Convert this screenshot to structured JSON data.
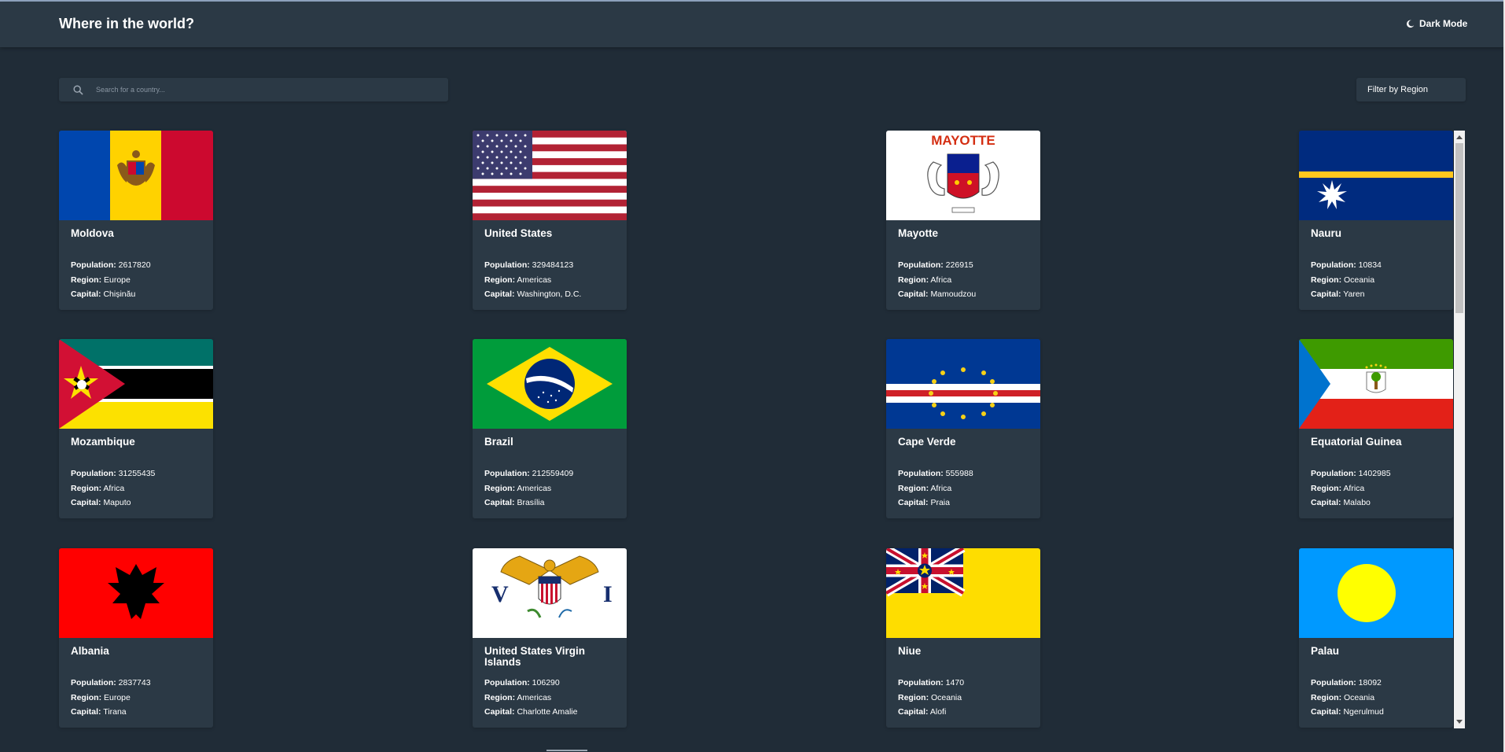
{
  "header": {
    "title": "Where in the world?",
    "dark_mode_label": "Dark Mode",
    "dark_mode_icon": "moon-icon"
  },
  "search": {
    "placeholder": "Search for a country...",
    "value": "",
    "icon": "search-icon"
  },
  "filter": {
    "label": "Filter by Region"
  },
  "labels": {
    "population": "Population:",
    "region": "Region:",
    "capital": "Capital:"
  },
  "colors": {
    "background": "#202c37",
    "surface": "#2b3945",
    "text": "#ffffff"
  },
  "countries": [
    {
      "name": "Moldova",
      "population": "2617820",
      "region": "Europe",
      "capital": "Chișinău",
      "flag": "moldova-flag"
    },
    {
      "name": "United States",
      "population": "329484123",
      "region": "Americas",
      "capital": "Washington, D.C.",
      "flag": "united-states-flag"
    },
    {
      "name": "Mayotte",
      "population": "226915",
      "region": "Africa",
      "capital": "Mamoudzou",
      "flag": "mayotte-flag",
      "flag_text": "MAYOTTE"
    },
    {
      "name": "Nauru",
      "population": "10834",
      "region": "Oceania",
      "capital": "Yaren",
      "flag": "nauru-flag"
    },
    {
      "name": "Mozambique",
      "population": "31255435",
      "region": "Africa",
      "capital": "Maputo",
      "flag": "mozambique-flag"
    },
    {
      "name": "Brazil",
      "population": "212559409",
      "region": "Americas",
      "capital": "Brasília",
      "flag": "brazil-flag"
    },
    {
      "name": "Cape Verde",
      "population": "555988",
      "region": "Africa",
      "capital": "Praia",
      "flag": "cape-verde-flag"
    },
    {
      "name": "Equatorial Guinea",
      "population": "1402985",
      "region": "Africa",
      "capital": "Malabo",
      "flag": "equatorial-guinea-flag"
    },
    {
      "name": "Albania",
      "population": "2837743",
      "region": "Europe",
      "capital": "Tirana",
      "flag": "albania-flag"
    },
    {
      "name": "United States Virgin Islands",
      "population": "106290",
      "region": "Americas",
      "capital": "Charlotte Amalie",
      "flag": "us-virgin-islands-flag"
    },
    {
      "name": "Niue",
      "population": "1470",
      "region": "Oceania",
      "capital": "Alofi",
      "flag": "niue-flag"
    },
    {
      "name": "Palau",
      "population": "18092",
      "region": "Oceania",
      "capital": "Ngerulmud",
      "flag": "palau-flag"
    }
  ]
}
